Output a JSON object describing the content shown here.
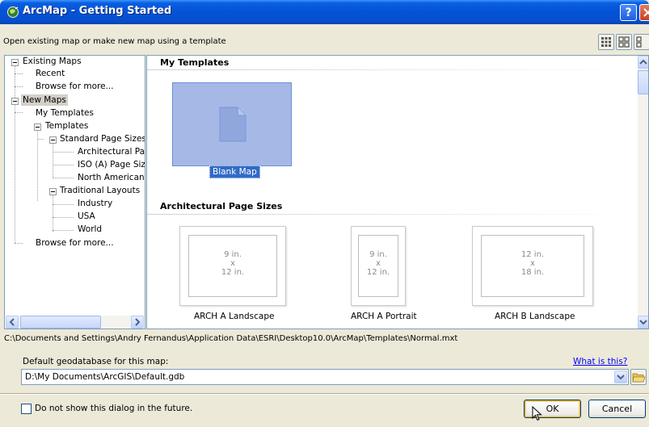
{
  "window": {
    "title": "ArcMap - Getting Started",
    "subtitle": "Open existing map or make new map using a template",
    "help_label": "?"
  },
  "tree": {
    "items": [
      {
        "label": "Existing Maps"
      },
      {
        "label": "Recent"
      },
      {
        "label": "Browse for more..."
      },
      {
        "label": "New Maps"
      },
      {
        "label": "My Templates"
      },
      {
        "label": "Templates"
      },
      {
        "label": "Standard Page Sizes"
      },
      {
        "label": "Architectural Pag"
      },
      {
        "label": "ISO (A) Page Siz"
      },
      {
        "label": "North American ("
      },
      {
        "label": "Traditional Layouts"
      },
      {
        "label": "Industry"
      },
      {
        "label": "USA"
      },
      {
        "label": "World"
      },
      {
        "label": "Browse for more..."
      }
    ],
    "selected": "New Maps"
  },
  "content": {
    "my_templates_heading": "My Templates",
    "blank_map_label": "Blank Map",
    "arch_heading": "Architectural Page Sizes",
    "thumbs": [
      {
        "label": "ARCH A Landscape",
        "w": "9 in.",
        "x": "x",
        "h": "12 in."
      },
      {
        "label": "ARCH A Portrait",
        "w": "9 in.",
        "x": "x",
        "h": "12 in."
      },
      {
        "label": "ARCH B Landscape",
        "w": "12 in.",
        "x": "x",
        "h": "18 in."
      }
    ]
  },
  "path": "C:\\Documents and Settings\\Andry Fernandus\\Application Data\\ESRI\\Desktop10.0\\ArcMap\\Templates\\Normal.mxt",
  "geodatabase": {
    "label": "Default geodatabase for this map:",
    "help_link": "What is this?",
    "value": "D:\\My Documents\\ArcGIS\\Default.gdb"
  },
  "footer": {
    "checkbox_label": "Do not show this dialog in the future.",
    "checkbox_checked": false,
    "ok_label": "OK",
    "cancel_label": "Cancel"
  },
  "icons": {
    "title": "arcmap-globe-icon",
    "help": "help-icon",
    "close": "close-icon",
    "views": [
      "thumbnail-view-icon",
      "large-thumbnail-view-icon",
      "list-view-icon"
    ],
    "blank_map": "blank-page-icon",
    "folder": "folder-open-icon",
    "combo": "chevron-down-icon"
  },
  "colors": {
    "title_bar": "#0453D7",
    "selection": "#316AC5",
    "blank_tile": "#A6B9E6",
    "link": "#0000FF"
  }
}
